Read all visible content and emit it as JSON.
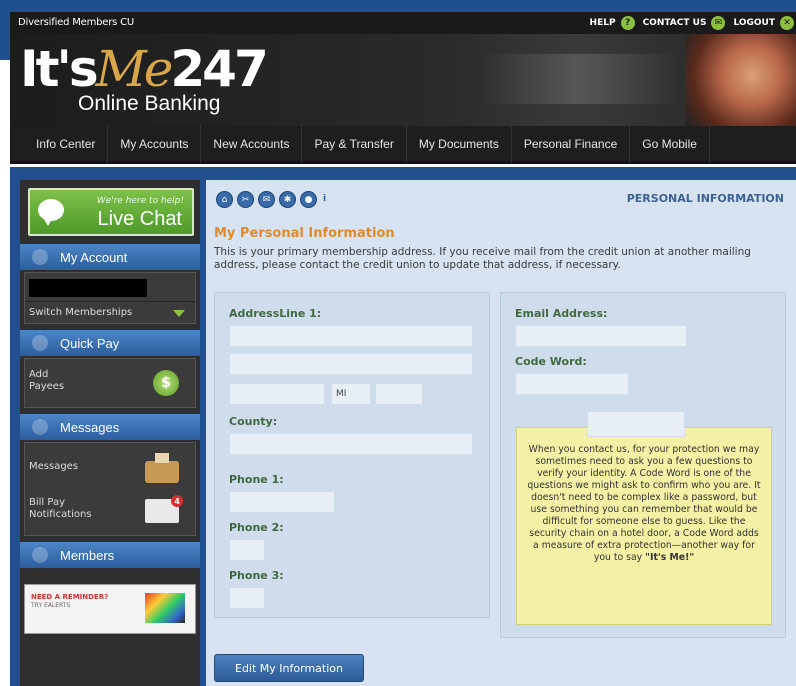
{
  "utility_bar": {
    "member_name": "Diversified Members CU",
    "links": [
      {
        "label": "HELP",
        "icon": "help-icon",
        "glyph": "?"
      },
      {
        "label": "CONTACT US",
        "icon": "mail-icon",
        "glyph": "✉"
      },
      {
        "label": "LOGOUT",
        "icon": "logout-icon",
        "glyph": "✕"
      }
    ]
  },
  "brand": {
    "its": "It's",
    "me": "Me",
    "num": "247",
    "sub": "Online Banking"
  },
  "nav": {
    "items": [
      "Info Center",
      "My Accounts",
      "New Accounts",
      "Pay & Transfer",
      "My Documents",
      "Personal Finance",
      "Go Mobile"
    ]
  },
  "sidebar": {
    "chat_helper": "We're here to help!",
    "chat_label": "Live Chat",
    "my_account": "My Account",
    "switch_memberships": "Switch Memberships",
    "quick_pay": "Quick Pay",
    "add_payees": "Add\nPayees",
    "messages_head": "Messages",
    "messages_item": "Messages",
    "bill_pay": "Bill Pay\nNotifications",
    "bill_badge": "4",
    "members_head": "Members",
    "reminder_title": "NEED A REMINDER?",
    "reminder_sub": "TRY EALERTS"
  },
  "content": {
    "page_label": "PERSONAL INFORMATION",
    "section_title": "My Personal Information",
    "description": "This is your primary membership address. If you receive mail from the credit union at another mailing address, please contact the credit union to update that address, if necessary.",
    "address_label": "AddressLine 1:",
    "state_value": "MI",
    "county_label": "County:",
    "phone1_label": "Phone 1:",
    "phone2_label": "Phone 2:",
    "phone3_label": "Phone 3:",
    "email_label": "Email Address:",
    "code_word_label": "Code Word:",
    "tip_text": "When you contact us, for your protection we may sometimes need to ask you a few questions to verify your identity. A Code Word is one of the questions we might ask to confirm who you are. It doesn't need to be complex like a password, but use something you can remember that would be difficult for someone else to guess. Like the security chain on a hotel door, a Code Word adds a measure of extra protection—another way for you to say",
    "tip_emphasis": "\"It's Me!\"",
    "edit_button": "Edit My Information"
  },
  "colors": {
    "accent_orange": "#e08a2a",
    "brand_blue": "#22508e",
    "chat_green": "#5fa833",
    "tip_yellow": "#f4f1a6"
  }
}
